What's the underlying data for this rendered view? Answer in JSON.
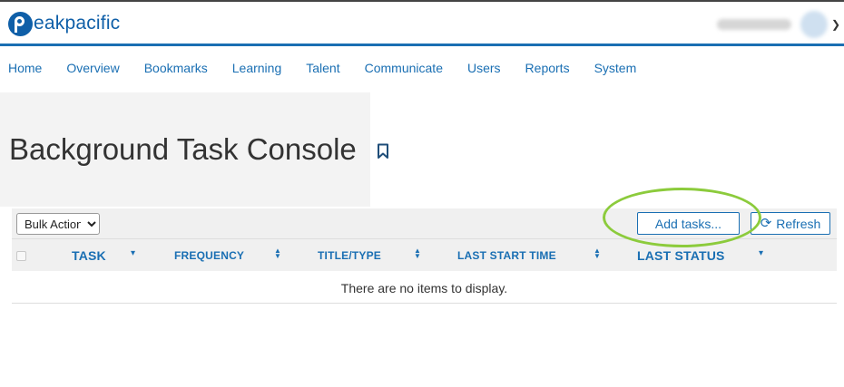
{
  "header": {
    "logo_text": "eakpacific"
  },
  "nav": {
    "items": [
      {
        "label": "Home"
      },
      {
        "label": "Overview"
      },
      {
        "label": "Bookmarks"
      },
      {
        "label": "Learning"
      },
      {
        "label": "Talent"
      },
      {
        "label": "Communicate"
      },
      {
        "label": "Users"
      },
      {
        "label": "Reports"
      },
      {
        "label": "System"
      }
    ]
  },
  "page": {
    "title": "Background Task Console"
  },
  "toolbar": {
    "bulk_action": {
      "selected": "Bulk Action",
      "options": [
        "Bulk Action"
      ]
    },
    "add_tasks_label": "Add tasks...",
    "refresh_label": "Refresh"
  },
  "table": {
    "columns": [
      {
        "label": "TASK"
      },
      {
        "label": "FREQUENCY"
      },
      {
        "label": "TITLE/TYPE"
      },
      {
        "label": "LAST START TIME"
      },
      {
        "label": "LAST STATUS"
      }
    ],
    "empty_message": "There are no items to display."
  },
  "colors": {
    "brand": "#1a6fb3",
    "highlight": "#8ccb3c"
  }
}
